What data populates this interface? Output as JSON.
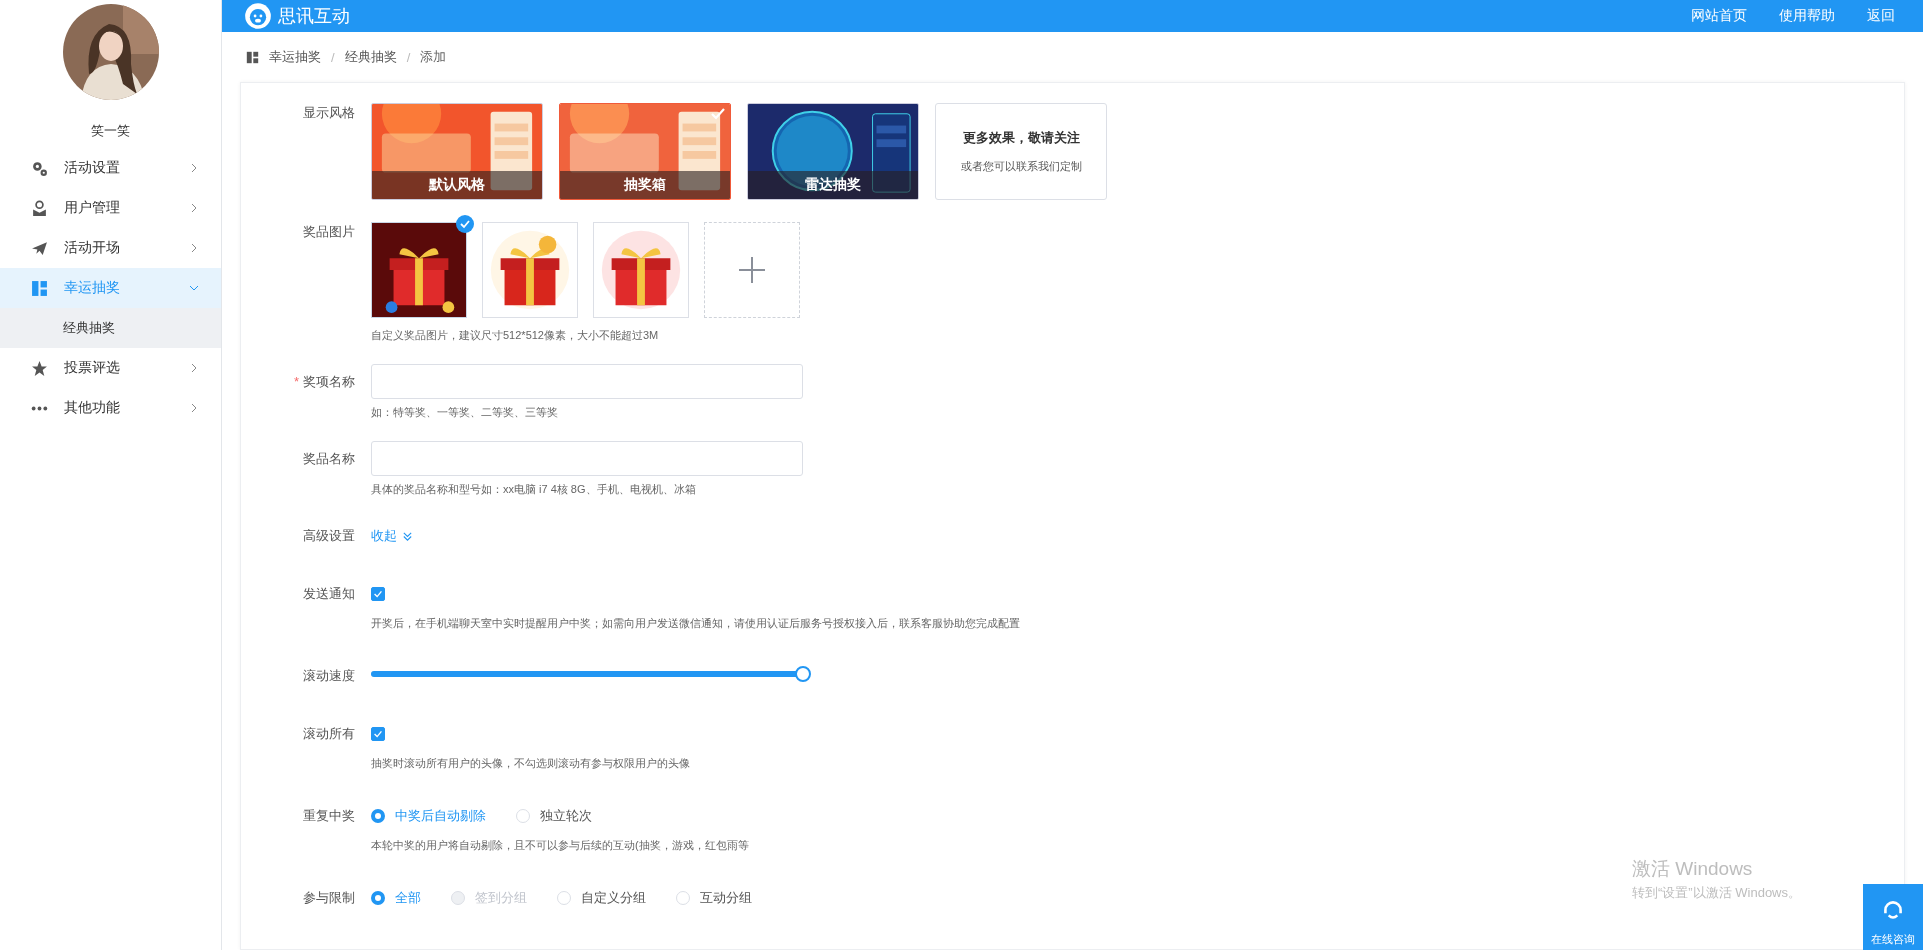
{
  "header": {
    "brand": "思讯互动",
    "links": [
      "网站首页",
      "使用帮助",
      "返回"
    ]
  },
  "sidebar": {
    "user": {
      "name": "笑一笑"
    },
    "items": [
      {
        "label": "活动设置",
        "selected": false,
        "expanded": false
      },
      {
        "label": "用户管理",
        "selected": false,
        "expanded": false
      },
      {
        "label": "活动开场",
        "selected": false,
        "expanded": false
      },
      {
        "label": "幸运抽奖",
        "selected": true,
        "expanded": true,
        "children": [
          {
            "label": "经典抽奖",
            "selected": true
          }
        ]
      },
      {
        "label": "投票评选",
        "selected": false,
        "expanded": false
      },
      {
        "label": "其他功能",
        "selected": false,
        "expanded": false
      }
    ]
  },
  "breadcrumb": {
    "separator": "/",
    "items": [
      "幸运抽奖",
      "经典抽奖",
      "添加"
    ]
  },
  "form": {
    "rows": [
      {
        "kind": "styles",
        "label": "显示风格",
        "options": [
          {
            "caption": "默认风格",
            "selected": false
          },
          {
            "caption": "抽奖箱",
            "selected": true
          },
          {
            "caption": "雷达抽奖",
            "selected": false
          }
        ],
        "more": {
          "title": "更多效果，敬请关注",
          "subtitle": "或者您可以联系我们定制"
        }
      },
      {
        "kind": "images",
        "label": "奖品图片",
        "images": [
          {
            "selected": true
          },
          {
            "selected": false
          },
          {
            "selected": false
          }
        ],
        "hint": "自定义奖品图片，建议尺寸512*512像素，大小不能超过3M"
      },
      {
        "kind": "input",
        "label": "奖项名称",
        "required_mark": "*",
        "hint": "如：特等奖、一等奖、二等奖、三等奖"
      },
      {
        "kind": "input",
        "label": "奖品名称",
        "hint": "具体的奖品名称和型号如：xx电脑 i7 4核 8G、手机、电视机、冰箱"
      },
      {
        "kind": "toggle",
        "label": "高级设置",
        "link": "收起"
      },
      {
        "kind": "checkbox",
        "label": "发送通知",
        "checked": true,
        "hint": "开奖后，在手机端聊天室中实时提醒用户中奖；如需向用户发送微信通知，请使用认证后服务号授权接入后，联系客服协助您完成配置"
      },
      {
        "kind": "slider",
        "label": "滚动速度",
        "level": 1
      },
      {
        "kind": "checkbox",
        "label": "滚动所有",
        "checked": true,
        "hint": "抽奖时滚动所有用户的头像，不勾选则滚动有参与权限用户的头像"
      },
      {
        "kind": "radio",
        "label": "重复中奖",
        "options": [
          {
            "label": "中奖后自动剔除",
            "selected": true,
            "disabled": false
          },
          {
            "label": "独立轮次",
            "selected": false,
            "disabled": false
          }
        ],
        "hint": "本轮中奖的用户将自动剔除，且不可以参与后续的互动(抽奖，游戏，红包雨等"
      },
      {
        "kind": "radio",
        "label": "参与限制",
        "options": [
          {
            "label": "全部",
            "selected": true,
            "disabled": false
          },
          {
            "label": "签到分组",
            "selected": false,
            "disabled": true
          },
          {
            "label": "自定义分组",
            "selected": false,
            "disabled": false
          },
          {
            "label": "互动分组",
            "selected": false,
            "disabled": false
          }
        ]
      }
    ]
  },
  "windows_notice": {
    "title": "激活 Windows",
    "subtitle": "转到“设置”以激活 Windows。"
  },
  "chat": {
    "label": "在线咨询"
  }
}
